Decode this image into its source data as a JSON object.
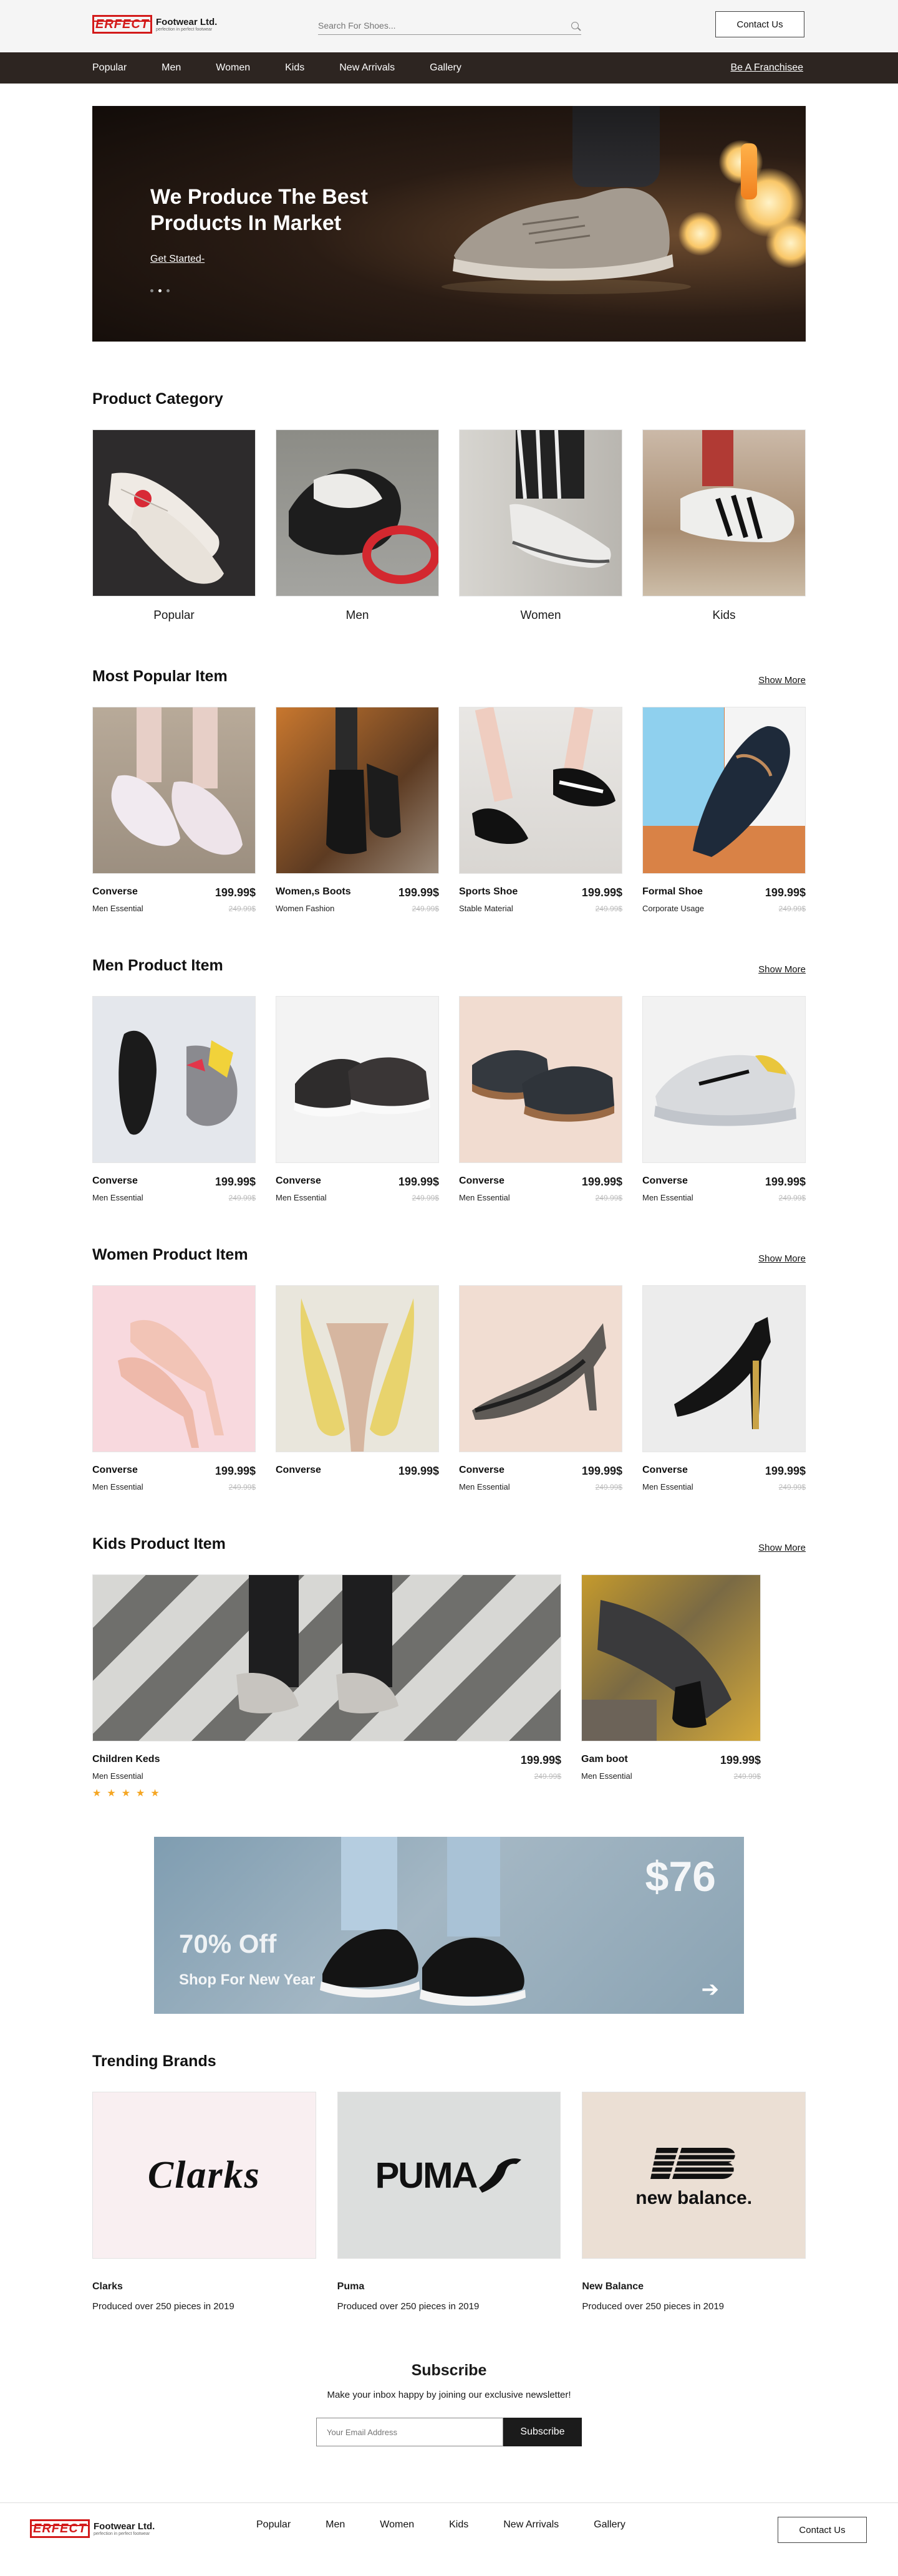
{
  "header": {
    "logo_mark": "ERFECT",
    "logo_name": "Footwear Ltd.",
    "logo_tagline": "perfection in perfect footwear",
    "search_placeholder": "Search For Shoes...",
    "contact_label": "Contact Us"
  },
  "nav": {
    "items": [
      "Popular",
      "Men",
      "Women",
      "Kids",
      "New Arrivals",
      "Gallery"
    ],
    "franchise": "Be A Franchisee"
  },
  "hero": {
    "title": "We Produce The Best Products In Market",
    "cta": "Get Started-",
    "slides": 3,
    "active_slide": 2
  },
  "category": {
    "title": "Product Category",
    "items": [
      {
        "label": "Popular"
      },
      {
        "label": "Men"
      },
      {
        "label": "Women"
      },
      {
        "label": "Kids"
      }
    ]
  },
  "popular": {
    "title": "Most Popular Item",
    "show_more": "Show More",
    "items": [
      {
        "name": "Converse",
        "sub": "Men Essential",
        "price": "199.99$",
        "old": "249.99$"
      },
      {
        "name": "Women,s Boots",
        "sub": "Women Fashion",
        "price": "199.99$",
        "old": "249.99$"
      },
      {
        "name": "Sports Shoe",
        "sub": "Stable Material",
        "price": "199.99$",
        "old": "249.99$"
      },
      {
        "name": "Formal Shoe",
        "sub": "Corporate Usage",
        "price": "199.99$",
        "old": "249.99$"
      }
    ]
  },
  "men": {
    "title": "Men Product Item",
    "show_more": "Show More",
    "items": [
      {
        "name": "Converse",
        "sub": "Men Essential",
        "price": "199.99$",
        "old": "249.99$"
      },
      {
        "name": "Converse",
        "sub": "Men Essential",
        "price": "199.99$",
        "old": "249.99$"
      },
      {
        "name": "Converse",
        "sub": "Men Essential",
        "price": "199.99$",
        "old": "249.99$"
      },
      {
        "name": "Converse",
        "sub": "Men Essential",
        "price": "199.99$",
        "old": "249.99$"
      }
    ]
  },
  "women": {
    "title": "Women Product Item",
    "show_more": "Show More",
    "items": [
      {
        "name": "Converse",
        "sub": "Men Essential",
        "price": "199.99$",
        "old": "249.99$"
      },
      {
        "name": "Converse",
        "sub": "",
        "price": "199.99$",
        "old": ""
      },
      {
        "name": "Converse",
        "sub": "Men Essential",
        "price": "199.99$",
        "old": "249.99$"
      },
      {
        "name": "Converse",
        "sub": "Men Essential",
        "price": "199.99$",
        "old": "249.99$"
      }
    ]
  },
  "kids": {
    "title": "Kids Product Item",
    "show_more": "Show More",
    "items": [
      {
        "name": "Children Keds",
        "sub": "Men Essential",
        "price": "199.99$",
        "old": "249.99$",
        "rating": 5
      },
      {
        "name": "Gam boot",
        "sub": "Men Essential",
        "price": "199.99$",
        "old": "249.99$"
      }
    ]
  },
  "promo": {
    "off": "70% Off",
    "sub": "Shop For New Year",
    "price": "$76"
  },
  "brands": {
    "title": "Trending Brands",
    "items": [
      {
        "logo": "Clarks",
        "name": "Clarks",
        "sub": "Produced over 250 pieces in 2019",
        "bg": "#f9eff1"
      },
      {
        "logo": "PUMA",
        "name": "Puma",
        "sub": "Produced over 250 pieces in 2019",
        "bg": "#dcdedd"
      },
      {
        "logo": "new balance.",
        "name": "New Balance",
        "sub": "Produced over 250 pieces in 2019",
        "bg": "#ebdfd4"
      }
    ]
  },
  "subscribe": {
    "title": "Subscribe",
    "text": "Make your inbox happy by joining our exclusive newsletter!",
    "placeholder": "Your Email Address",
    "button": "Subscribe"
  },
  "footer": {
    "nav": [
      "Popular",
      "Men",
      "Women",
      "Kids",
      "New Arrivals",
      "Gallery"
    ],
    "contact_label": "Contact Us"
  },
  "colors": {
    "accent": "#d31a1a",
    "nav_bg": "#2d2521",
    "star": "#f5a623"
  }
}
